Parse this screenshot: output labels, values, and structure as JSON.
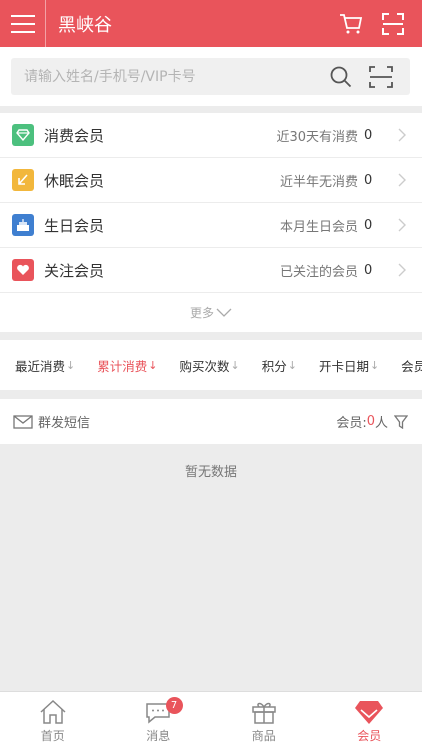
{
  "header": {
    "title": "黑峡谷",
    "accent": "#e9545b"
  },
  "search": {
    "placeholder": "请输入姓名/手机号/VIP卡号"
  },
  "members": [
    {
      "name": "消费会员",
      "desc": "近30天有消费",
      "count": "0",
      "icon": "diamond-icon",
      "color": "#4cc07e"
    },
    {
      "name": "休眠会员",
      "desc": "近半年无消费",
      "count": "0",
      "icon": "sleep-arrow-icon",
      "color": "#f2b73c"
    },
    {
      "name": "生日会员",
      "desc": "本月生日会员",
      "count": "0",
      "icon": "cake-icon",
      "color": "#3f7fd0"
    },
    {
      "name": "关注会员",
      "desc": "已关注的会员",
      "count": "0",
      "icon": "heart-icon",
      "color": "#e9545b"
    }
  ],
  "more_label": "更多",
  "sort": {
    "items": [
      "最近消费",
      "累计消费",
      "购买次数",
      "积分",
      "开卡日期",
      "会员钱"
    ],
    "active_index": 1
  },
  "actions": {
    "sms_label": "群发短信",
    "member_label": "会员:",
    "member_count": "0",
    "member_unit": "人"
  },
  "empty_text": "暂无数据",
  "tabs": [
    {
      "label": "首页",
      "icon": "home-icon"
    },
    {
      "label": "消息",
      "icon": "message-icon",
      "badge": "7"
    },
    {
      "label": "商品",
      "icon": "gift-icon"
    },
    {
      "label": "会员",
      "icon": "vip-diamond-icon",
      "active": true
    }
  ]
}
